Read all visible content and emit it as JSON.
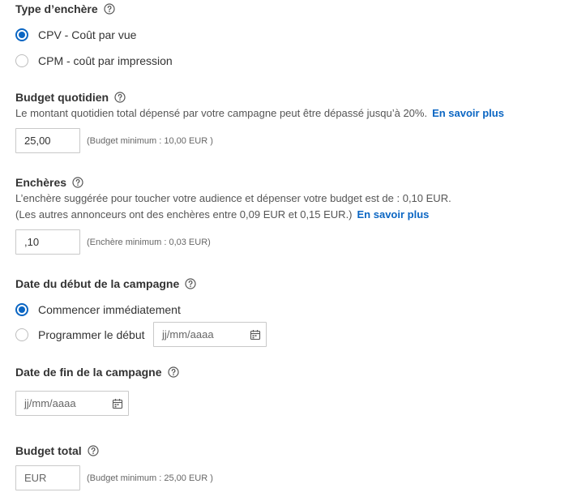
{
  "bid_type": {
    "title": "Type d’enchère",
    "options": [
      {
        "label": "CPV - Coût par vue",
        "selected": true
      },
      {
        "label": "CPM - coût par impression",
        "selected": false
      }
    ]
  },
  "daily_budget": {
    "title": "Budget quotidien",
    "description": "Le montant quotidien total dépensé par votre campagne peut être dépassé jusqu’à 20%.",
    "link": "En savoir plus",
    "value": "25,00",
    "hint": "(Budget minimum : 10,00 EUR )"
  },
  "bids": {
    "title": "Enchères",
    "description_line1": "L’enchère suggérée pour toucher votre audience et dépenser votre budget est de : 0,10 EUR.",
    "description_line2": "(Les autres annonceurs ont des enchères entre 0,09 EUR et 0,15 EUR.)",
    "link": "En savoir plus",
    "value": ",10",
    "hint": "(Enchère minimum : 0,03 EUR)"
  },
  "start_date": {
    "title": "Date du début de la campagne",
    "options": [
      {
        "label": "Commencer immédiatement",
        "selected": true
      },
      {
        "label": "Programmer le début",
        "selected": false
      }
    ],
    "date_placeholder": "jj/mm/aaaa"
  },
  "end_date": {
    "title": "Date de fin de la campagne",
    "date_placeholder": "jj/mm/aaaa"
  },
  "total_budget": {
    "title": "Budget total",
    "placeholder": "EUR",
    "hint": "(Budget minimum : 25,00 EUR )"
  },
  "colors": {
    "accent": "#0b66c3",
    "text": "#333333",
    "muted": "#666666",
    "border": "#c9c9c9"
  },
  "icons": {
    "help": "help-circle-icon",
    "calendar": "calendar-icon"
  }
}
